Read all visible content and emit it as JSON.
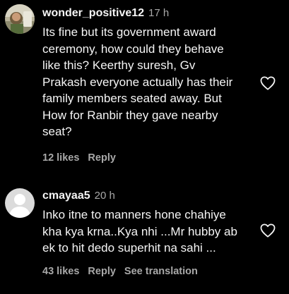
{
  "comments": [
    {
      "username": "wonder_positive12",
      "time": "17 h",
      "text_lines": [
        "Its fine but its government award",
        "ceremony, how could they behave",
        "like this? Keerthy suresh, Gv",
        "Prakash everyone actually has their",
        "family members seated away. But",
        "How for Ranbir they gave nearby",
        "seat?"
      ],
      "likes": "12 likes",
      "reply_label": "Reply",
      "avatar_icon": "profile-photo",
      "like_icon": "heart-outline-icon"
    },
    {
      "username": "cmayaa5",
      "time": "20 h",
      "text_lines": [
        "Inko itne to manners hone chahiye",
        "kha kya krna..Kya nhi ...Mr hubby ab",
        "ek to hit dedo superhit na sahi ..."
      ],
      "likes": "43 likes",
      "reply_label": "Reply",
      "see_translation_label": "See translation",
      "avatar_icon": "default-avatar",
      "like_icon": "heart-outline-icon"
    }
  ],
  "colors": {
    "background": "#000000",
    "primary_text": "#f5f5f5",
    "secondary_text": "#a8a8a8",
    "default_avatar_bg": "#dbdbdb"
  }
}
